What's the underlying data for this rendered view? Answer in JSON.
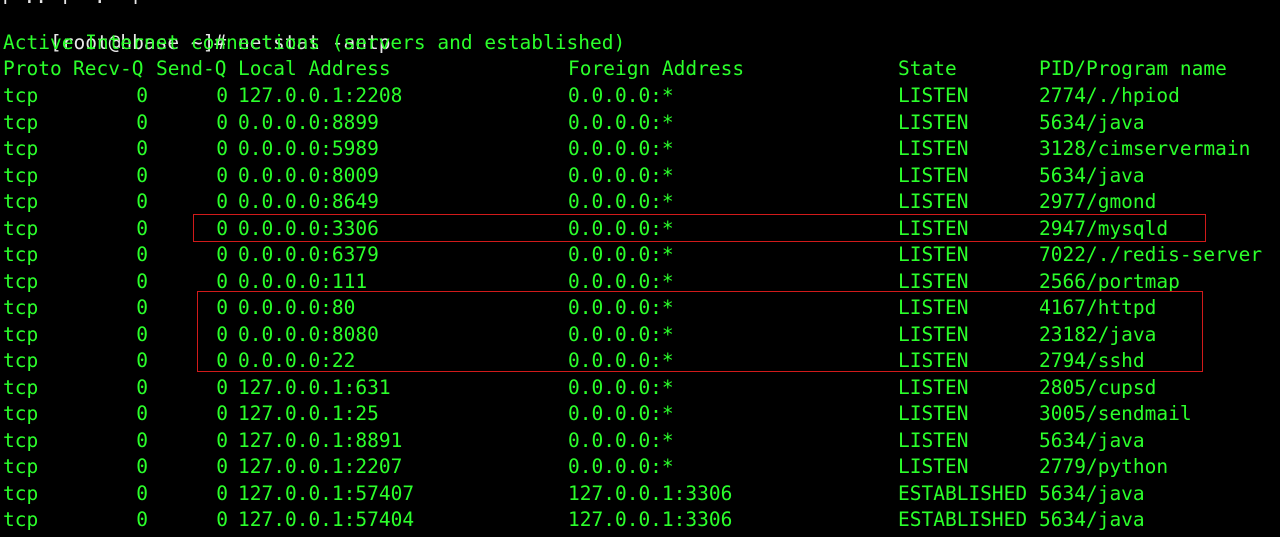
{
  "colors": {
    "background": "#000000",
    "text": "#2bff2b",
    "prompt_text": "#e8e8e8",
    "highlight_border": "#d11a1a"
  },
  "terminal": {
    "top_fragment": "[ .. ]  .  ]",
    "prompt": "[root@hbase ~]#",
    "command": "netstat -antp",
    "banner": "Active Internet connections (servers and established)",
    "headers": {
      "proto": "Proto",
      "recv_q": "Recv-Q",
      "send_q": "Send-Q",
      "local": "Local Address",
      "foreign": "Foreign Address",
      "state": "State",
      "pid": "PID/Program name"
    },
    "rows": [
      {
        "proto": "tcp",
        "recv": "0",
        "send": "0",
        "local": "127.0.0.1:2208",
        "foreign": "0.0.0.0:*",
        "state": "LISTEN",
        "pid": "2774/./hpiod"
      },
      {
        "proto": "tcp",
        "recv": "0",
        "send": "0",
        "local": "0.0.0.0:8899",
        "foreign": "0.0.0.0:*",
        "state": "LISTEN",
        "pid": "5634/java"
      },
      {
        "proto": "tcp",
        "recv": "0",
        "send": "0",
        "local": "0.0.0.0:5989",
        "foreign": "0.0.0.0:*",
        "state": "LISTEN",
        "pid": "3128/cimservermain"
      },
      {
        "proto": "tcp",
        "recv": "0",
        "send": "0",
        "local": "0.0.0.0:8009",
        "foreign": "0.0.0.0:*",
        "state": "LISTEN",
        "pid": "5634/java"
      },
      {
        "proto": "tcp",
        "recv": "0",
        "send": "0",
        "local": "0.0.0.0:8649",
        "foreign": "0.0.0.0:*",
        "state": "LISTEN",
        "pid": "2977/gmond"
      },
      {
        "proto": "tcp",
        "recv": "0",
        "send": "0",
        "local": "0.0.0.0:3306",
        "foreign": "0.0.0.0:*",
        "state": "LISTEN",
        "pid": "2947/mysqld"
      },
      {
        "proto": "tcp",
        "recv": "0",
        "send": "0",
        "local": "0.0.0.0:6379",
        "foreign": "0.0.0.0:*",
        "state": "LISTEN",
        "pid": "7022/./redis-server"
      },
      {
        "proto": "tcp",
        "recv": "0",
        "send": "0",
        "local": "0.0.0.0:111",
        "foreign": "0.0.0.0:*",
        "state": "LISTEN",
        "pid": "2566/portmap"
      },
      {
        "proto": "tcp",
        "recv": "0",
        "send": "0",
        "local": "0.0.0.0:80",
        "foreign": "0.0.0.0:*",
        "state": "LISTEN",
        "pid": "4167/httpd"
      },
      {
        "proto": "tcp",
        "recv": "0",
        "send": "0",
        "local": "0.0.0.0:8080",
        "foreign": "0.0.0.0:*",
        "state": "LISTEN",
        "pid": "23182/java"
      },
      {
        "proto": "tcp",
        "recv": "0",
        "send": "0",
        "local": "0.0.0.0:22",
        "foreign": "0.0.0.0:*",
        "state": "LISTEN",
        "pid": "2794/sshd"
      },
      {
        "proto": "tcp",
        "recv": "0",
        "send": "0",
        "local": "127.0.0.1:631",
        "foreign": "0.0.0.0:*",
        "state": "LISTEN",
        "pid": "2805/cupsd"
      },
      {
        "proto": "tcp",
        "recv": "0",
        "send": "0",
        "local": "127.0.0.1:25",
        "foreign": "0.0.0.0:*",
        "state": "LISTEN",
        "pid": "3005/sendmail"
      },
      {
        "proto": "tcp",
        "recv": "0",
        "send": "0",
        "local": "127.0.0.1:8891",
        "foreign": "0.0.0.0:*",
        "state": "LISTEN",
        "pid": "5634/java"
      },
      {
        "proto": "tcp",
        "recv": "0",
        "send": "0",
        "local": "127.0.0.1:2207",
        "foreign": "0.0.0.0:*",
        "state": "LISTEN",
        "pid": "2779/python"
      },
      {
        "proto": "tcp",
        "recv": "0",
        "send": "0",
        "local": "127.0.0.1:57407",
        "foreign": "127.0.0.1:3306",
        "state": "ESTABLISHED",
        "pid": "5634/java"
      },
      {
        "proto": "tcp",
        "recv": "0",
        "send": "0",
        "local": "127.0.0.1:57404",
        "foreign": "127.0.0.1:3306",
        "state": "ESTABLISHED",
        "pid": "5634/java"
      }
    ]
  }
}
